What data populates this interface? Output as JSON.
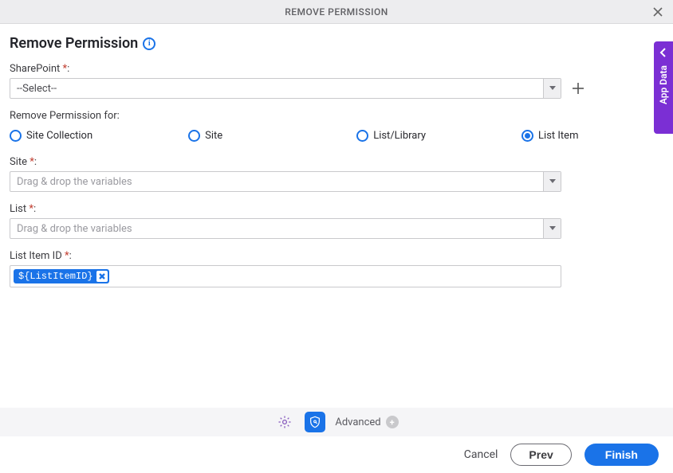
{
  "titlebar": {
    "title": "REMOVE PERMISSION"
  },
  "side_tab": {
    "label": "App Data"
  },
  "page_title": "Remove Permission",
  "fields": {
    "sharepoint": {
      "label": "SharePoint",
      "value": "--Select--"
    },
    "scope_label": "Remove Permission for:",
    "radios": [
      {
        "label": "Site Collection",
        "checked": false
      },
      {
        "label": "Site",
        "checked": false
      },
      {
        "label": "List/Library",
        "checked": false
      },
      {
        "label": "List Item",
        "checked": true
      }
    ],
    "site": {
      "label": "Site",
      "placeholder": "Drag & drop the variables"
    },
    "list": {
      "label": "List",
      "placeholder": "Drag & drop the variables"
    },
    "list_item_id": {
      "label": "List Item ID",
      "chip": "${ListItemID}"
    }
  },
  "toolbar": {
    "advanced": "Advanced"
  },
  "footer": {
    "cancel": "Cancel",
    "prev": "Prev",
    "finish": "Finish"
  }
}
